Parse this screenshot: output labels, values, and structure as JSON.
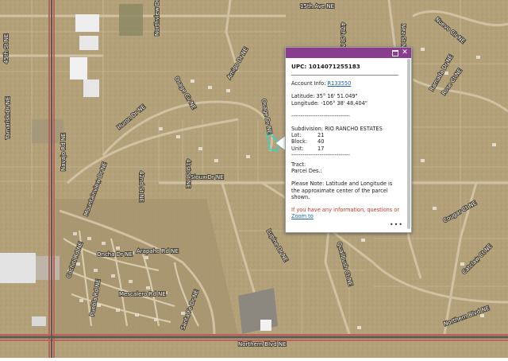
{
  "streets": {
    "s1": "15th Ave NE",
    "s2": "47th St NE",
    "s3": "Nez St NE",
    "s4": "Nuevo Cir NE",
    "s5": "45th St NE",
    "s6": "Osage Cir NE",
    "s7": "Amigo Dr NE",
    "s8": "Ramada Dr NE",
    "s9": "Rose Ct NE",
    "s10": "Huron Dr NE",
    "s11": "Osage Dr NE",
    "s12": "Sioux Dr NE",
    "s13": "42nd St NE",
    "s14": "41st St NE",
    "s15": "Tamarisk Dr NE",
    "s16": "Arapaho Rd NE",
    "s17": "Cochiti Rd NE",
    "s18": "Oncha Dr NE",
    "s19": "Mescalero Rd NE",
    "s20": "Santa Fe Dr NE",
    "s21": "Puebla Rd NE",
    "s22": "Navajo Rd NE",
    "s23": "Lupine Dr NE",
    "s24": "Northern Blvd NE",
    "s25": "Northern Blvd NE",
    "s26": "Catclaw Ct NE",
    "s27": "Cougar Ct NE",
    "s28": "Quailbush Ct NE",
    "s29": "Mountainview Dr NE",
    "s30": "Northview Dr NE"
  },
  "popup": {
    "upc": "UPC: 1014071255183",
    "account_label": "Account Info:",
    "account_link": "R133550",
    "latitude": "Latitude: 35° 16' 51.049\"",
    "longitude": "Longitude: -106° 38' 48.404\"",
    "dashes": "-------------------------------",
    "subdivision": "Subdivision: RIO RANCHO ESTATES",
    "lot_label": "Lot:",
    "lot_value": "21",
    "block_label": "Block:",
    "block_value": "40",
    "unit_label": "Unit:",
    "unit_value": "17",
    "tract": "Tract:",
    "parcel": "Parcel Des.:",
    "note": "Please Note: Latitude and Longitude is the approximate center of the parcel shown.",
    "info_request": "If you have any information, questions or",
    "zoom_link": "Zoom to",
    "more": "•••"
  },
  "colors": {
    "terrain": "#b5a27c",
    "popup_header": "#8a3c8f",
    "parcel_highlight": "#2fd6d0",
    "road_major": "#c0605c"
  }
}
